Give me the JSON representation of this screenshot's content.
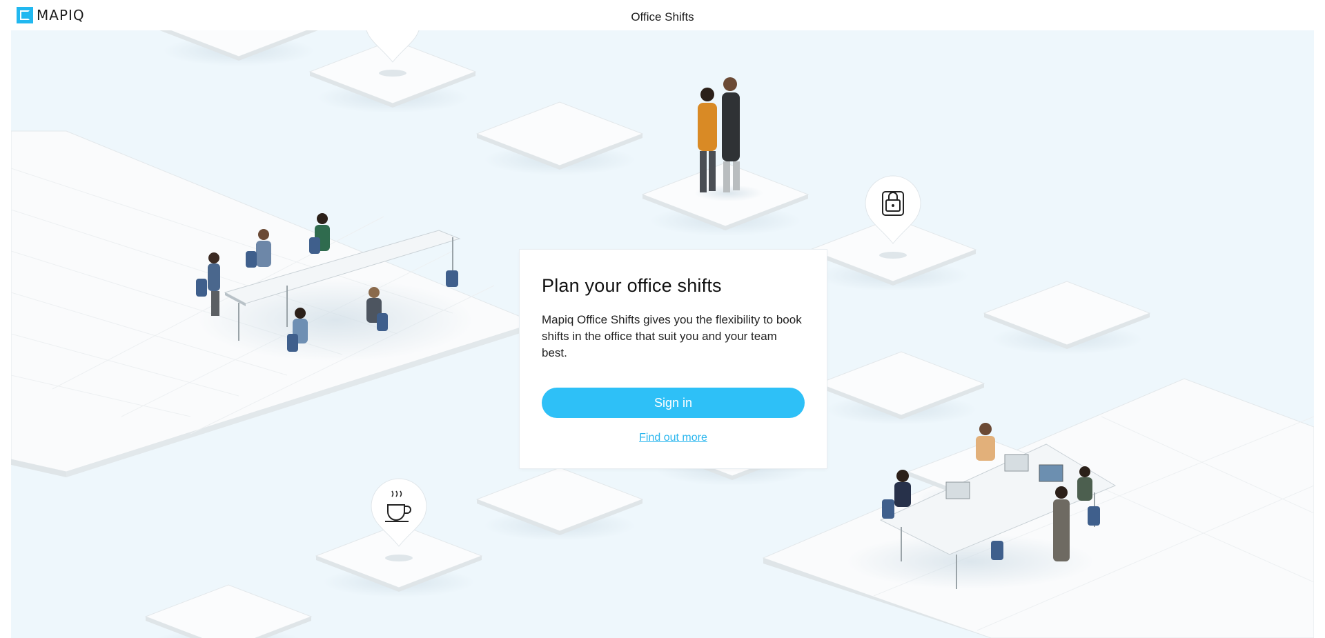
{
  "header": {
    "logo_text": "MAPIQ",
    "app_title": "Office Shifts"
  },
  "card": {
    "title": "Plan your office shifts",
    "description": "Mapiq Office Shifts gives you the flexibility to book shifts in the office that suit you and your team best.",
    "sign_in_label": "Sign in",
    "find_out_more_label": "Find out more"
  },
  "colors": {
    "accent": "#2ec0f7",
    "scene_background": "#eef7fc",
    "link": "#2ab6ee"
  },
  "icons": {
    "pins": [
      "lock-icon",
      "coffee-cup-icon",
      "chat-icon"
    ]
  }
}
